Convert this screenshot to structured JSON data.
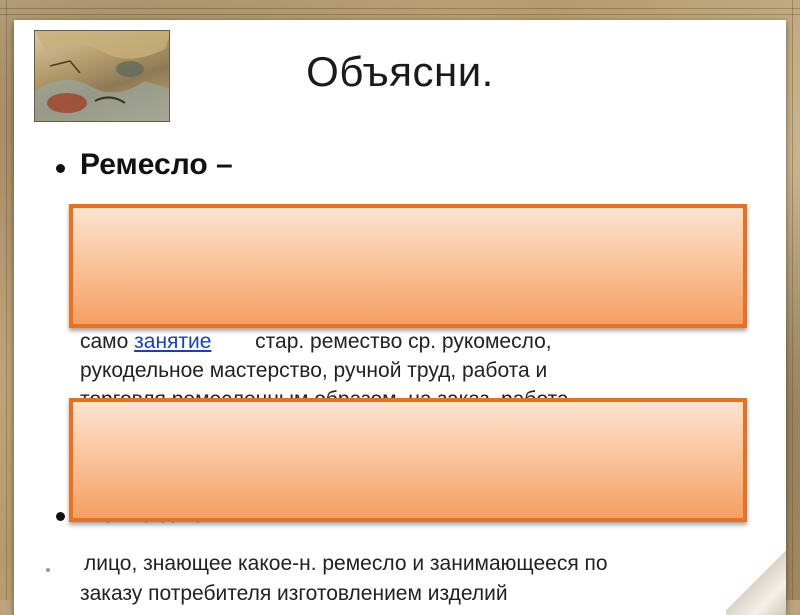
{
  "slide": {
    "title": "Объясни.",
    "thumbnail_icon": "antique-map-thumbnail"
  },
  "bullets": [
    {
      "term": "Ремесло –",
      "definition": {
        "prefix": "само",
        "link": "занятие",
        "suffix": "стар. ремество ср. рукомесло,",
        "line2": "рукодельное мастерство, ручной труд, работа и",
        "line3_partial": "торговля ремесленным образом, на заказ, работа"
      }
    },
    {
      "term": "Ремесленник",
      "definition": {
        "line1": "лицо, знающее какое-н. ремесло и занимающееся по",
        "line2": "заказу потребителя изготовлением изделий"
      }
    }
  ],
  "colors": {
    "cover_border": "#e8711f",
    "cover_fill": "#fbc59e",
    "link": "#1b3cc9"
  }
}
